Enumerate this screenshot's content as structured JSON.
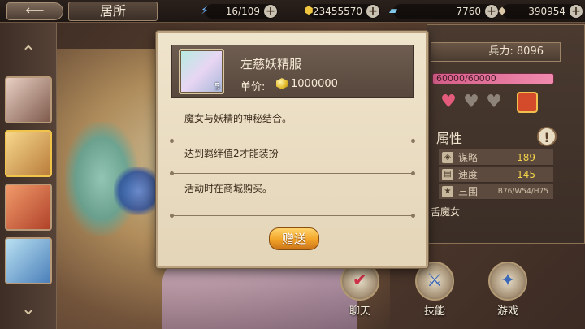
{
  "topbar": {
    "back_icon": "back-arrow-icon",
    "title": "居所",
    "stamina": "16/109",
    "gold": "23455570",
    "tickets": "7760",
    "gems": "390954"
  },
  "right_panel": {
    "power_label": "兵力: 8096",
    "hp": "60000/60000",
    "attr_title": "属性",
    "info_symbol": "!",
    "attrs": [
      {
        "label": "谋略",
        "value": "189"
      },
      {
        "label": "速度",
        "value": "145"
      },
      {
        "label": "三围",
        "value": "B76/W54/H75"
      }
    ],
    "lower_text": "舌魔女"
  },
  "actions": [
    {
      "label": "聊天",
      "icon": "heart-chat-icon"
    },
    {
      "label": "技能",
      "icon": "skill-icon"
    },
    {
      "label": "游戏",
      "icon": "game-icon"
    }
  ],
  "dialog": {
    "item_name": "左慈妖精服",
    "item_count": "5",
    "price_label": "单价:",
    "price_value": "1000000",
    "description": "魔女与妖精的神秘结合。",
    "requirement": "达到羁绊值2才能装扮",
    "source": "活动时在商城购买。",
    "gift_button": "赠送"
  },
  "colors": {
    "accent_gold": "#f2a326",
    "dialog_bg": "#efe4cc",
    "hp_pink": "#f28aae"
  }
}
